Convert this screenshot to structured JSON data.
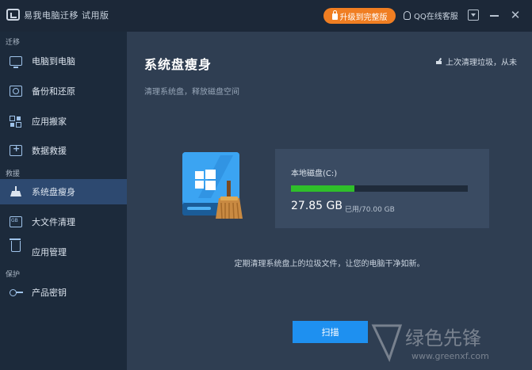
{
  "titlebar": {
    "app_title": "易我电脑迁移 试用版",
    "upgrade_label": "升级到完整版",
    "qq_label": "QQ在线客服"
  },
  "sidebar": {
    "groups": [
      {
        "label": "迁移"
      },
      {
        "label": "救援"
      },
      {
        "label": "保护"
      }
    ],
    "items": [
      {
        "label": "电脑到电脑",
        "icon": "monitor-icon"
      },
      {
        "label": "备份和还原",
        "icon": "backup-icon"
      },
      {
        "label": "应用搬家",
        "icon": "apps-icon"
      },
      {
        "label": "数据救援",
        "icon": "rescue-icon"
      },
      {
        "label": "系统盘瘦身",
        "icon": "broom-icon",
        "active": true
      },
      {
        "label": "大文件清理",
        "icon": "big-file-icon"
      },
      {
        "label": "应用管理",
        "icon": "trash-icon"
      },
      {
        "label": "产品密钥",
        "icon": "key-icon"
      }
    ]
  },
  "main": {
    "title": "系统盘瘦身",
    "subtitle": "清理系统盘，释放磁盘空间",
    "last_clean": "上次清理垃圾，从未",
    "disk": {
      "name": "本地磁盘(C:)",
      "used": "27.85 GB",
      "total": "已用/70.00 GB",
      "fill_fraction": 0.36,
      "fill_color": "#2fbf2a"
    },
    "hint": "定期清理系统盘上的垃圾文件，让您的电脑干净如新。",
    "scan_label": "扫描"
  },
  "watermark": {
    "text": "绿色先锋",
    "url": "www.greenxf.com"
  },
  "colors": {
    "accent": "#1e90f0",
    "upgrade": "#f07e22",
    "sidebar_active": "#2d4970"
  }
}
